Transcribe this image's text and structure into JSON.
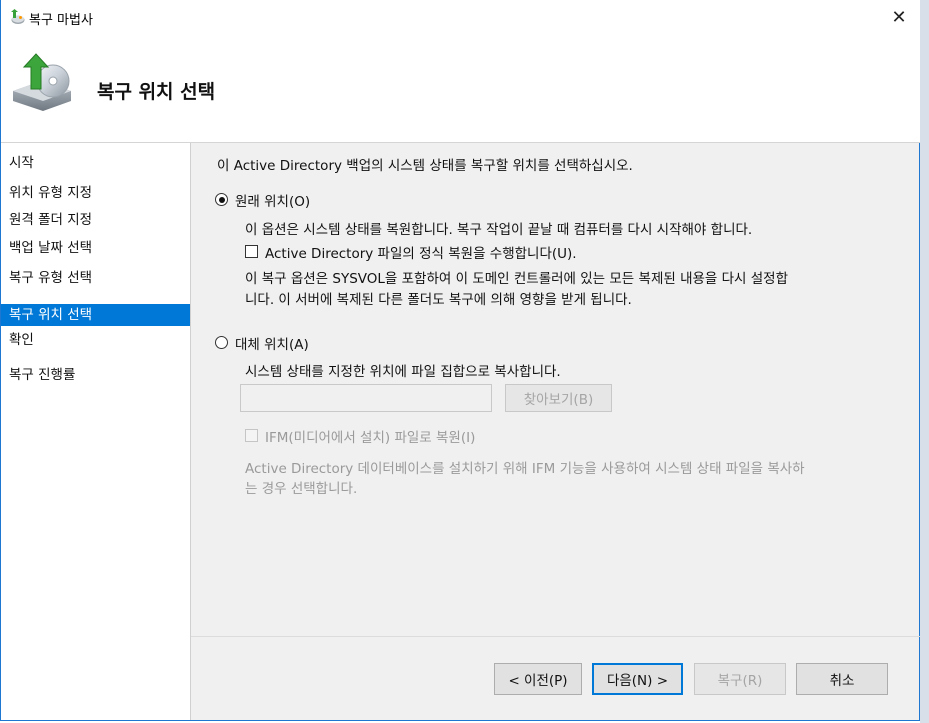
{
  "window": {
    "title": "복구 마법사",
    "app_icon": "restore-wizard-icon",
    "close_icon": "close-icon"
  },
  "header": {
    "title": "복구 위치 선택",
    "icon": "backup-restore-disk-icon"
  },
  "sidebar": {
    "items": [
      {
        "label": "시작",
        "active": false
      },
      {
        "label": "위치 유형 지정",
        "active": false
      },
      {
        "label": "원격 폴더 지정",
        "active": false
      },
      {
        "label": "백업 날짜 선택",
        "active": false
      },
      {
        "label": "복구 유형 선택",
        "active": false
      },
      {
        "label": "복구 위치 선택",
        "active": true
      },
      {
        "label": "확인",
        "active": false
      },
      {
        "label": "복구 진행률",
        "active": false
      }
    ],
    "active_color": "#0078d7"
  },
  "main": {
    "instruction": "이 Active Directory 백업의 시스템 상태를 복구할 위치를 선택하십시오.",
    "original": {
      "label": "원래 위치(O)",
      "selected": true,
      "description": "이 옵션은 시스템 상태를 복원합니다. 복구 작업이 끝날 때 컴퓨터를 다시 시작해야 합니다.",
      "authoritative_label": "Active Directory 파일의 정식 복원을 수행합니다(U).",
      "authoritative_checked": false,
      "note_line1": "이 복구 옵션은 SYSVOL을 포함하여 이 도메인 컨트롤러에 있는 모든 복제된 내용을 다시 설정합",
      "note_line2": "니다. 이 서버에 복제된 다른 폴더도 복구에 의해 영향을 받게 됩니다."
    },
    "alternate": {
      "label": "대체 위치(A)",
      "selected": false,
      "description": "시스템 상태를 지정한 위치에 파일 집합으로 복사합니다.",
      "path_value": "",
      "browse_label": "찾아보기(B)",
      "ifm_label": "IFM(미디어에서 설치) 파일로 복원(I)",
      "ifm_checked": false,
      "ifm_note_line1": "Active Directory 데이터베이스를 설치하기 위해 IFM 기능을 사용하여 시스템 상태 파일을 복사하",
      "ifm_note_line2": "는 경우 선택합니다."
    }
  },
  "footer": {
    "prev_label": "< 이전(P)",
    "next_label": "다음(N) >",
    "recover_label": "복구(R)",
    "cancel_label": "취소"
  }
}
